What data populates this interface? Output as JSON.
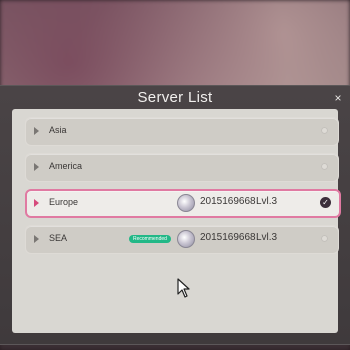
{
  "dialog": {
    "title": "Server List",
    "close_glyph": "×"
  },
  "servers": [
    {
      "name": "Asia",
      "selected": false,
      "recommended": false,
      "account": "",
      "level": ""
    },
    {
      "name": "America",
      "selected": false,
      "recommended": false,
      "account": "",
      "level": ""
    },
    {
      "name": "Europe",
      "selected": true,
      "recommended": false,
      "account": "2015169668",
      "level": "Lvl.3"
    },
    {
      "name": "SEA",
      "selected": false,
      "recommended": true,
      "badge": "Recommended",
      "account": "2015169668",
      "level": "Lvl.3"
    }
  ],
  "icons": {
    "arrow": "play-arrow-icon",
    "check": "checkmark-icon",
    "avatar": "player-avatar-icon",
    "cursor": "mouse-pointer-icon",
    "close": "close-icon"
  },
  "colors": {
    "selected_border": "#e07aa2",
    "selected_arrow": "#d64a7c",
    "recommended_badge": "#22b887",
    "panel": "#d9d7d2",
    "dialog": "#444042"
  },
  "glyphs": {
    "check": "✓"
  }
}
